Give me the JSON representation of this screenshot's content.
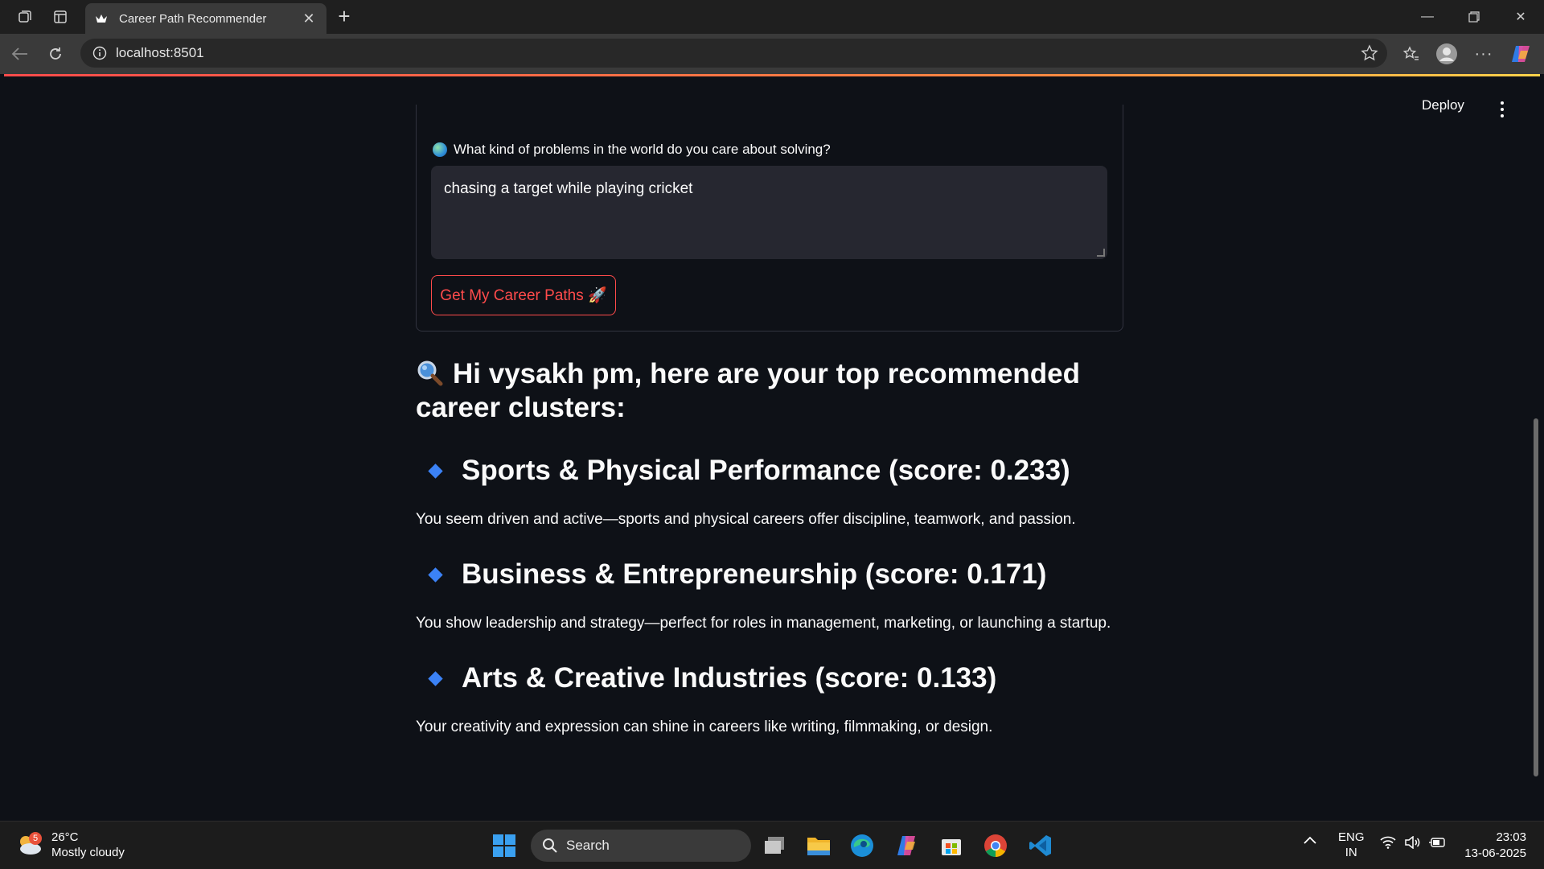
{
  "browser": {
    "tab_title": "Career Path Recommender",
    "url": "localhost:8501"
  },
  "app_header": {
    "deploy_label": "Deploy"
  },
  "form": {
    "question_label": "What kind of problems in the world do you care about solving?",
    "textarea_value": "chasing a target while playing cricket",
    "submit_label": "Get My Career Paths 🚀"
  },
  "results": {
    "heading": "Hi vysakh pm, here are your top recommended career clusters:",
    "clusters": [
      {
        "title": "Sports & Physical Performance (score: 0.233)",
        "description": "You seem driven and active—sports and physical careers offer discipline, teamwork, and passion."
      },
      {
        "title": "Business & Entrepreneurship (score: 0.171)",
        "description": "You show leadership and strategy—perfect for roles in management, marketing, or launching a startup."
      },
      {
        "title": "Arts & Creative Industries (score: 0.133)",
        "description": "Your creativity and expression can shine in careers like writing, filmmaking, or design."
      }
    ]
  },
  "taskbar": {
    "weather_temp": "26°C",
    "weather_desc": "Mostly cloudy",
    "weather_badge": "5",
    "search_label": "Search",
    "lang_top": "ENG",
    "lang_bottom": "IN",
    "time": "23:03",
    "date": "13-06-2025"
  },
  "colors": {
    "accent": "#ff4b4b",
    "background": "#0e1117",
    "diamond": "#3b82f6"
  }
}
